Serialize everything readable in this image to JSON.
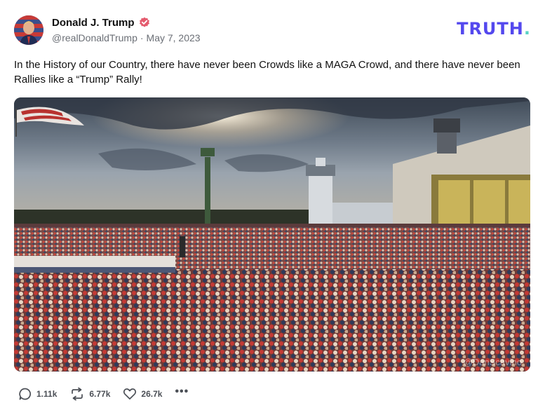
{
  "author": {
    "display_name": "Donald J. Trump",
    "handle": "@realDonaldTrump",
    "separator": "·",
    "date": "May 7, 2023",
    "verified_icon": "verified-badge-icon",
    "verified_color": "#e45b6e"
  },
  "brand": {
    "logo_text": "TRUTH",
    "logo_dot": ".",
    "logo_color": "#5448ee",
    "dot_color": "#58d3c4"
  },
  "post": {
    "text": "In the History of our Country, there have never been Crowds like a MAGA Crowd, and there have never been Rallies like a “Trump” Rally!",
    "image_watermark": "@DanScavino"
  },
  "actions": {
    "replies": {
      "icon": "reply-icon",
      "count": "1.11k"
    },
    "retruths": {
      "icon": "retruth-icon",
      "count": "6.77k"
    },
    "likes": {
      "icon": "heart-icon",
      "count": "26.7k"
    },
    "more": {
      "icon": "more-options-icon",
      "label": "•••"
    }
  }
}
